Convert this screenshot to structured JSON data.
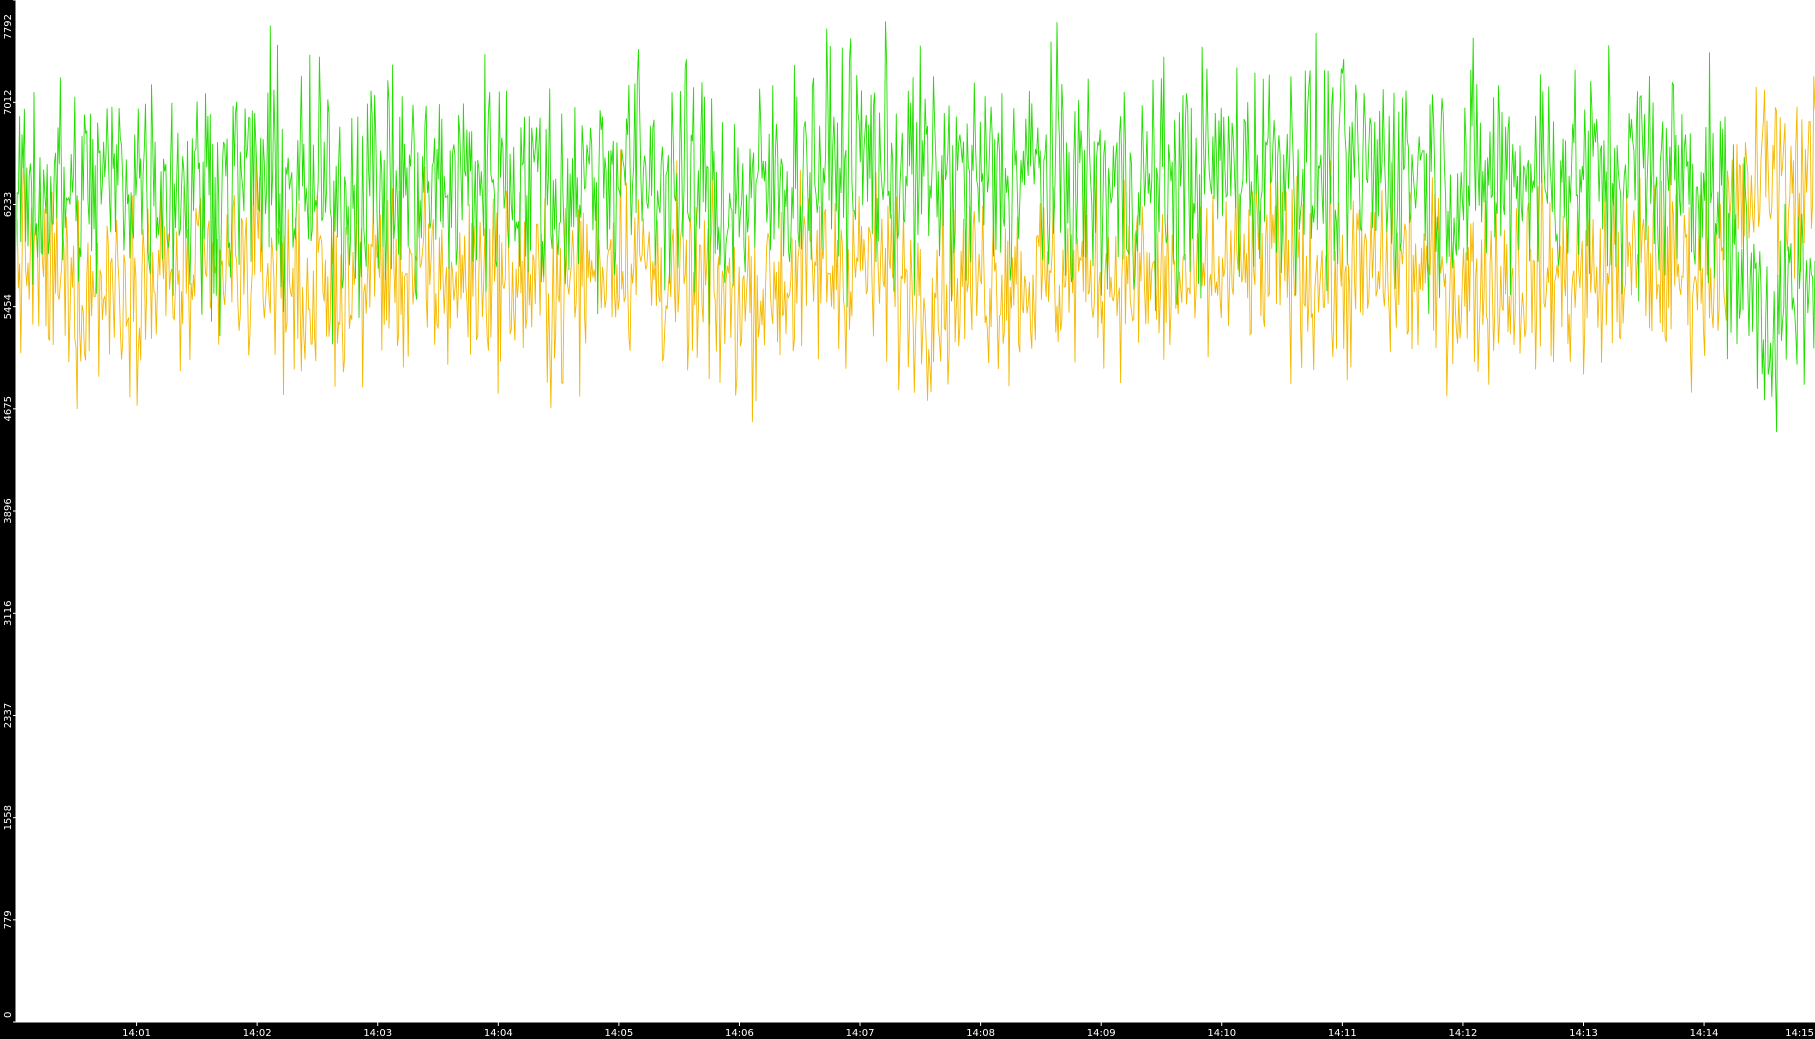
{
  "chart_data": {
    "type": "line",
    "title": "",
    "xlabel": "",
    "ylabel": "",
    "grid": false,
    "legend": "none",
    "background": "#000000",
    "plot_background": "#ffffff",
    "axis_text_color": "#ffffff",
    "ylim": [
      0,
      7792
    ],
    "yticks": [
      0,
      779,
      1558,
      2337,
      3116,
      3896,
      4675,
      5454,
      6233,
      7012,
      7792
    ],
    "xlim_minutes": [
      0.0,
      14.92
    ],
    "xticks": [
      {
        "label": "14:01",
        "minute": 1
      },
      {
        "label": "14:02",
        "minute": 2
      },
      {
        "label": "14:03",
        "minute": 3
      },
      {
        "label": "14:04",
        "minute": 4
      },
      {
        "label": "14:05",
        "minute": 5
      },
      {
        "label": "14:06",
        "minute": 6
      },
      {
        "label": "14:07",
        "minute": 7
      },
      {
        "label": "14:08",
        "minute": 8
      },
      {
        "label": "14:09",
        "minute": 9
      },
      {
        "label": "14:10",
        "minute": 10
      },
      {
        "label": "14:11",
        "minute": 11
      },
      {
        "label": "14:12",
        "minute": 12
      },
      {
        "label": "14:13",
        "minute": 13
      },
      {
        "label": "14:14",
        "minute": 14
      },
      {
        "label": "14:15",
        "minute": 15
      }
    ],
    "series": [
      {
        "color": "#f5b800",
        "x": [
          0,
          0.5,
          1,
          1.5,
          2,
          2.5,
          3,
          3.5,
          4,
          4.5,
          5,
          5.5,
          6,
          6.5,
          7,
          7.5,
          8,
          8.5,
          9,
          9.5,
          10,
          10.5,
          11,
          11.5,
          12,
          12.5,
          13,
          13.5,
          14,
          14.5,
          14.92
        ],
        "y": [
          5850,
          5550,
          5700,
          5600,
          5800,
          5500,
          5750,
          5650,
          5700,
          5550,
          5900,
          5600,
          5500,
          5700,
          5800,
          5550,
          5700,
          5650,
          5750,
          5600,
          5700,
          5800,
          5650,
          5750,
          5600,
          5700,
          5650,
          5800,
          5700,
          6500,
          6400
        ]
      },
      {
        "color": "#22dd00",
        "x": [
          0,
          0.5,
          1,
          1.5,
          2,
          2.5,
          3,
          3.5,
          4,
          4.5,
          5,
          5.5,
          6,
          6.5,
          7,
          7.5,
          8,
          8.5,
          9,
          9.5,
          10,
          10.5,
          11,
          11.5,
          12,
          12.5,
          13,
          13.5,
          14,
          14.5,
          14.92
        ],
        "y": [
          6400,
          6300,
          6500,
          6350,
          6450,
          6300,
          6400,
          6350,
          6500,
          6300,
          6550,
          6400,
          6250,
          6500,
          6600,
          6450,
          6400,
          6500,
          6350,
          6400,
          6500,
          6600,
          6450,
          6550,
          6400,
          6500,
          6450,
          6500,
          6450,
          5400,
          5500
        ]
      }
    ]
  }
}
